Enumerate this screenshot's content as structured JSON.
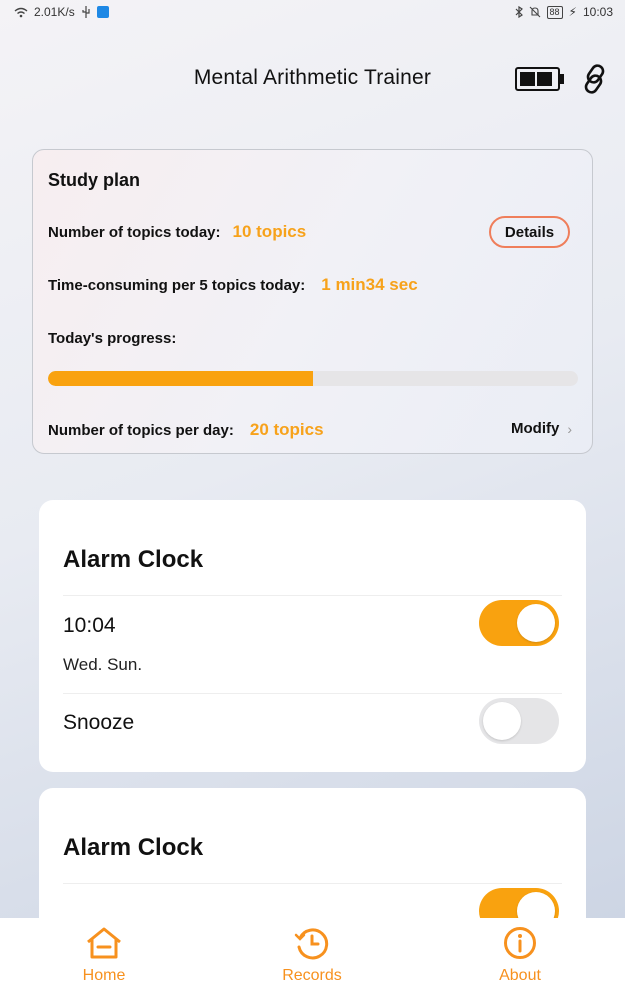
{
  "status_bar": {
    "net_speed": "2.01K/s",
    "battery_level": "88",
    "time": "10:03"
  },
  "header": {
    "title": "Mental Arithmetic Trainer",
    "icons": [
      "battery-icon",
      "link-icon"
    ]
  },
  "study_plan": {
    "title": "Study plan",
    "topics_today_label": "Number of topics today:",
    "topics_today_value": "10 topics",
    "details_label": "Details",
    "time_label": "Time-consuming per 5 topics today:",
    "time_value": "1 min34 sec",
    "progress_label": "Today's progress:",
    "progress_fraction": 0.5,
    "per_day_label": "Number of topics per day:",
    "per_day_value": "20 topics",
    "modify_label": "Modify"
  },
  "alarms": [
    {
      "title": "Alarm Clock",
      "time": "10:04",
      "days": "Wed. Sun.",
      "enabled": true,
      "snooze_label": "Snooze",
      "snooze_enabled": false
    },
    {
      "title": "Alarm Clock",
      "enabled": true
    }
  ],
  "bottom_nav": {
    "items": [
      {
        "label": "Home",
        "icon": "home-icon"
      },
      {
        "label": "Records",
        "icon": "clock-icon"
      },
      {
        "label": "About",
        "icon": "info-icon"
      }
    ],
    "accent": "#f7911e"
  },
  "colors": {
    "accent": "#f9a20f",
    "details_border": "#ef7e5b"
  }
}
